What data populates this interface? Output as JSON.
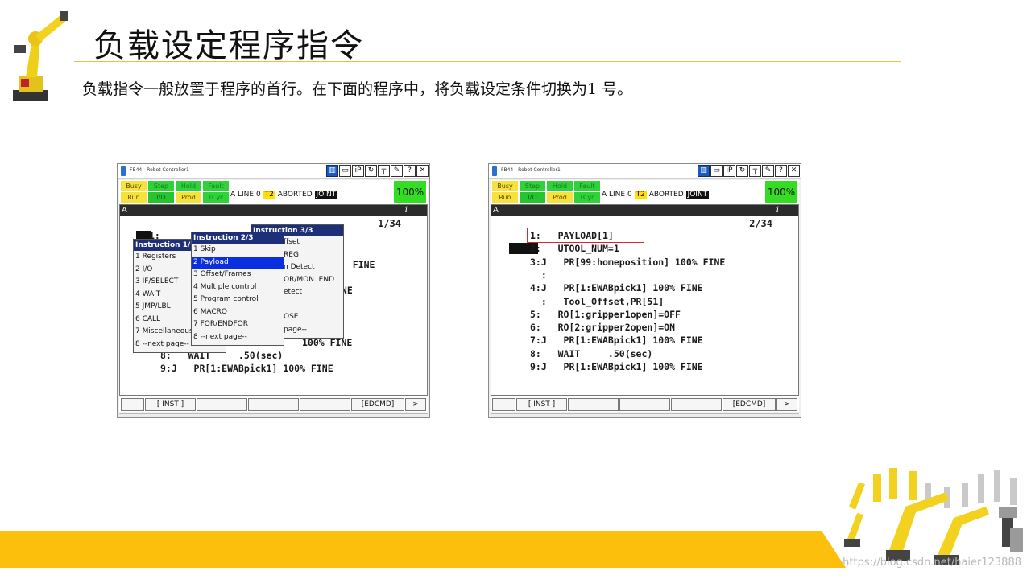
{
  "slide": {
    "title": "负载设定程序指令",
    "subtitle": "负载指令一般放置于程序的首行。在下面的程序中，将负载设定条件切换为1 号。",
    "watermark": "https://blog.csdn.net/haier123888"
  },
  "colors": {
    "accent": "#fbbf0c",
    "menu_header": "#1e2f7a",
    "menu_selection": "#0a2fe0",
    "override_green": "#33dd22",
    "highlight_box": "#e0262a"
  },
  "pendant_common": {
    "window_title": "FB44 - Robot Controller1",
    "title_buttons": [
      "trash-icon",
      "keyboard-icon",
      "iP",
      "refresh-icon",
      "tree-icon",
      "edit-icon",
      "help-icon",
      "close-icon"
    ],
    "leds": {
      "busy": "Busy",
      "step": "Step",
      "hold": "Hold",
      "fault": "Fault",
      "run": "Run",
      "io": "I/O",
      "prod": "Prod",
      "tcyc": "TCyc"
    },
    "status": {
      "prefix": "A  LINE 0",
      "mode": "T2",
      "state": "ABORTED",
      "coord": "JOINT"
    },
    "override": "100%",
    "screen_header": "A",
    "info_icon": "i",
    "fkeys": [
      "",
      "[ INST ]",
      "",
      "",
      "",
      "[EDCMD]",
      ">"
    ]
  },
  "pendant1": {
    "page_no": "1/34",
    "lines_visible": [
      "1:",
      "%  FINE",
      "INE",
      "8:   WAIT     .50(sec)",
      "9:J   PR[1:EWABpick1] 100% FINE"
    ],
    "line7_tail": "100% FINE",
    "menu1": {
      "header": "Instruction  1/",
      "items": [
        "1 Registers",
        "2 I/O",
        "3 IF/SELECT",
        "4 WAIT",
        "5 JMP/LBL",
        "6 CALL",
        "7 Miscellaneous",
        "8 --next page--"
      ]
    },
    "menu2": {
      "header": "Instruction  2/3",
      "items": [
        "1 Skip",
        "2 Payload",
        "3 Offset/Frames",
        "4 Multiple control",
        "5 Program control",
        "6 MACRO",
        "7 FOR/ENDFOR",
        "8 --next page--"
      ],
      "selected": "2 Payload"
    },
    "menu3": {
      "header": "Instruction  3/3",
      "items": [
        "ffset",
        "REG",
        "n Detect",
        "OR/MON. END",
        "etect",
        "",
        "OSE",
        "page--"
      ]
    }
  },
  "pendant2": {
    "page_no": "2/34",
    "program": [
      "1:   PAYLOAD[1]",
      "2:   UTOOL_NUM=1",
      "3:J   PR[99:homeposition] 100% FINE",
      "  :",
      "4:J   PR[1:EWABpick1] 100% FINE",
      "  :   Tool_Offset,PR[51]",
      "5:   RO[1:gripper1open]=OFF",
      "6:   RO[2:gripper2open]=ON",
      "7:J   PR[1:EWABpick1] 100% FINE",
      "8:   WAIT     .50(sec)",
      "9:J   PR[1:EWABpick1] 100% FINE"
    ]
  }
}
